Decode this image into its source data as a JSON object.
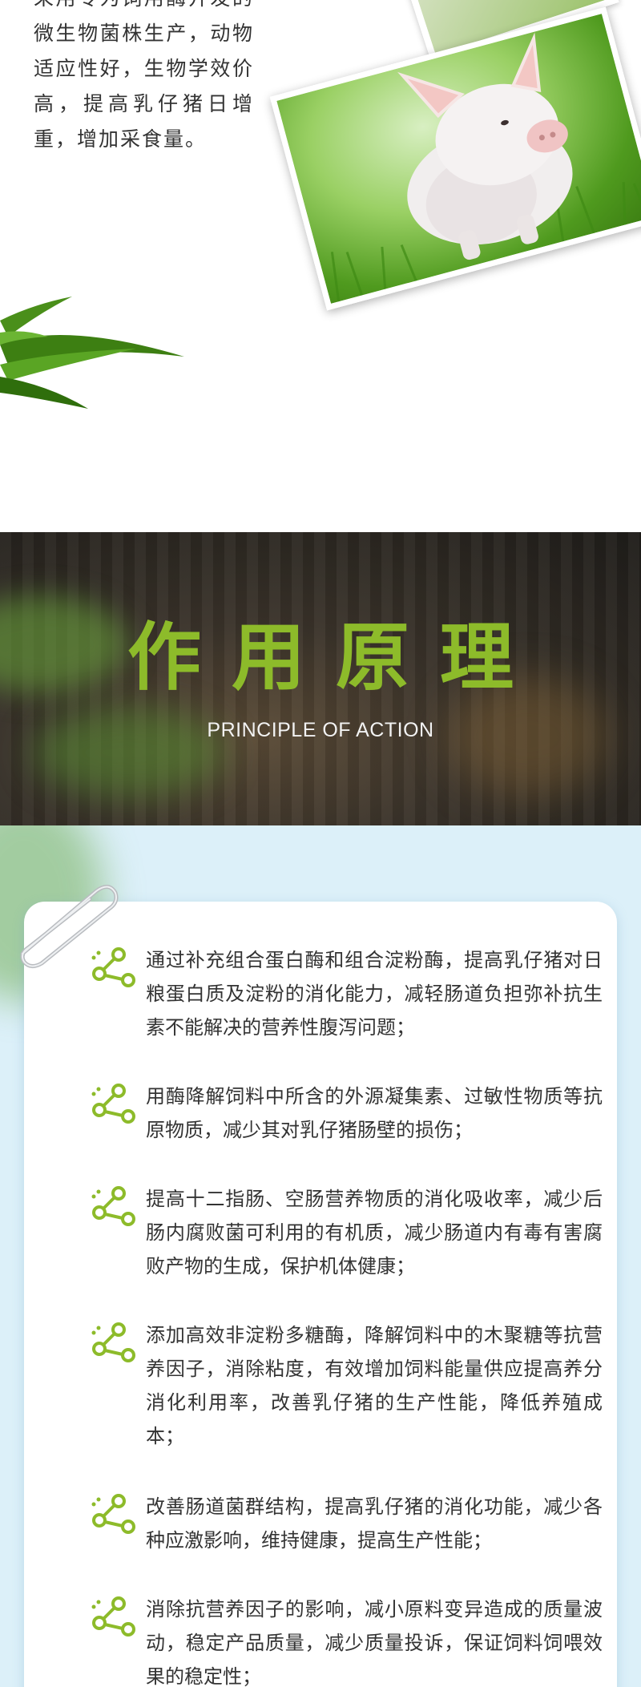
{
  "intro": {
    "text": "采用专为饲用酶开发的微生物菌株生产，动物适应性好，生物学效价高，提高乳仔猪日增重，增加采食量。"
  },
  "banner": {
    "title": "作用原理",
    "subtitle": "PRINCIPLE OF ACTION"
  },
  "colors": {
    "title_green": "#8dbb2a",
    "icon_green": "#8dbb2a",
    "content_bg": "#dcf0f9",
    "text": "#333333"
  },
  "principles": [
    "通过补充组合蛋白酶和组合淀粉酶，提高乳仔猪对日粮蛋白质及淀粉的消化能力，减轻肠道负担弥补抗生素不能解决的营养性腹泻问题；",
    "用酶降解饲料中所含的外源凝集素、过敏性物质等抗原物质，减少其对乳仔猪肠壁的损伤；",
    "提高十二指肠、空肠营养物质的消化吸收率，减少后肠内腐败菌可利用的有机质，减少肠道内有毒有害腐败产物的生成，保护机体健康；",
    "添加高效非淀粉多糖酶，降解饲料中的木聚糖等抗营养因子，消除粘度，有效增加饲料能量供应提高养分消化利用率，改善乳仔猪的生产性能，降低养殖成本；",
    "改善肠道菌群结构，提高乳仔猪的消化功能，减少各种应激影响，维持健康，提高生产性能；",
    "消除抗营养因子的影响，减小原料变异造成的质量波动，稳定产品质量，减少质量投诉，保证饲料饲喂效果的稳定性；"
  ],
  "icons": {
    "bullet": "share-nodes-icon",
    "clip": "paperclip-icon",
    "photo": "piglet-photo",
    "leaf": "grass-leaf-decoration"
  }
}
